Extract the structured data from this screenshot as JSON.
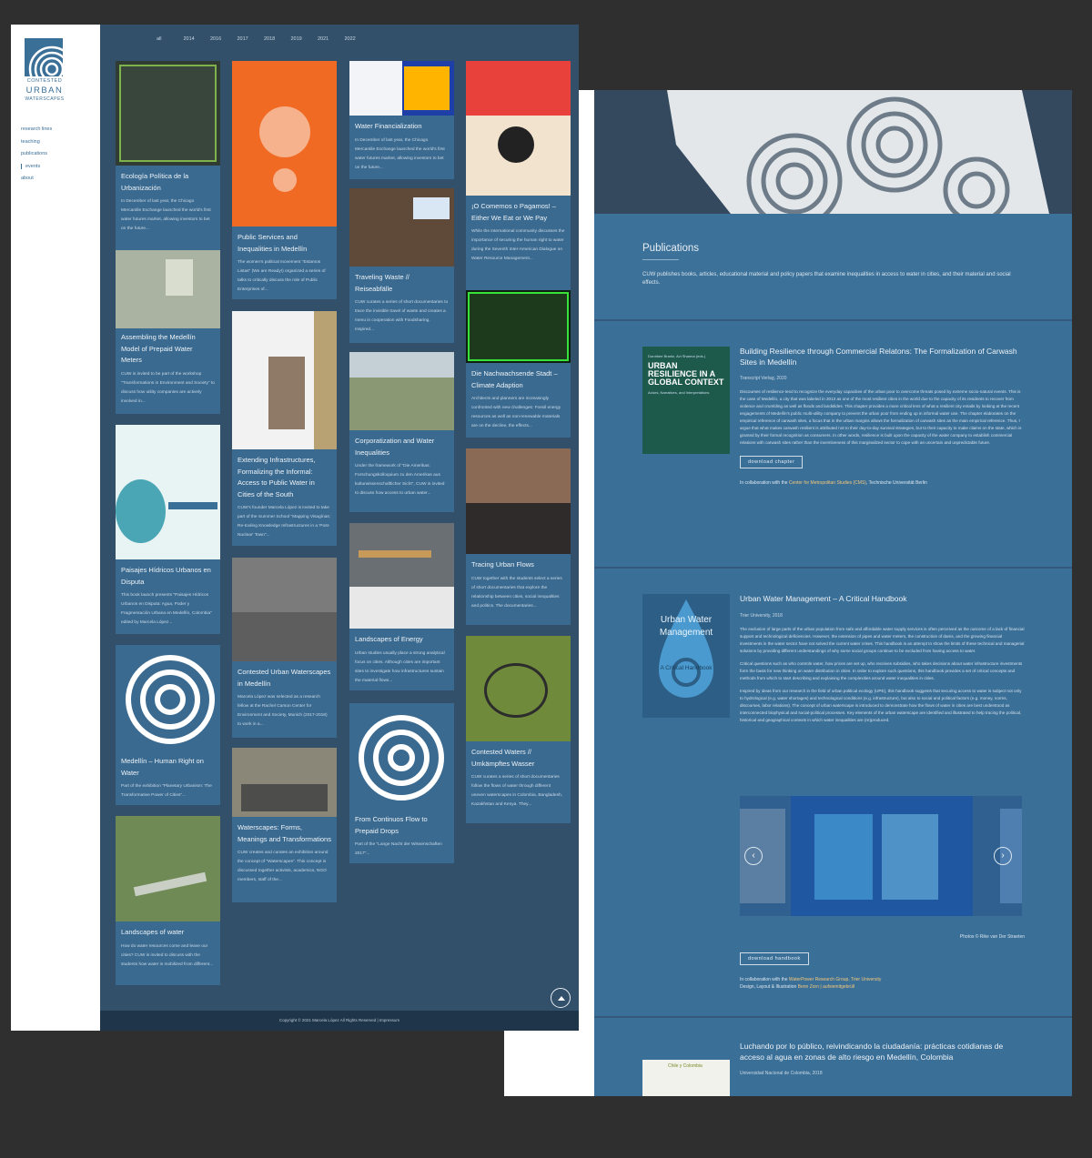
{
  "front": {
    "logo": {
      "line1": "CONTESTED",
      "line2": "URBAN",
      "line3": "WATERSCAPES"
    },
    "nav": [
      "research lines",
      "teaching",
      "publications",
      "events",
      "about"
    ],
    "years": [
      "all",
      "2014",
      "2016",
      "2017",
      "2018",
      "2019",
      "2021",
      "2022"
    ],
    "footer": "Copyright © 2021 Marcela López All Rights Reserved   |   Impressum",
    "cards": [
      {
        "title": "Ecología Política de la Urbanización",
        "desc": "In December of last year, the Chicago Mercantile Exchange launched the world's first water futures market, allowing investors to bet on the future..."
      },
      {
        "title": "Assembling the Medellín Model of Prepaid Water Meters",
        "desc": "CUW is invited to be part of the workshop \"Transformations in Environment and Society\" to discuss how utility companies are actively involved in..."
      },
      {
        "title": "Paisajes Hídricos Urbanos en Disputa",
        "desc": "This book launch presents \"Paisajes Hídricos Urbanos en Disputa: Agua, Poder y Fragmentación Urbana en Medellín, Colombia\" edited by Marcela López..."
      },
      {
        "title": "Medellín – Human Right on Water",
        "desc": "Part of the exhibition \"Planetary Urbanism: The Transformative Power of Cities\"..."
      },
      {
        "title": "Landscapes of water",
        "desc": "How do water resources come and leave our cities? CUW is invited to discuss with the students how water is mobilized from different..."
      },
      {
        "title": "Public Services and Inequalities in Medellín",
        "desc": "The women's political movement \"Estamos Listas\" (We are Ready!) organized a series of talks to critically discuss the role of Public Enterprises of..."
      },
      {
        "title": "Extending Infrastructures, Formalizing the Informal: Access to Public Water in Cities of the South",
        "desc": "CUW's founder Marcela López is invited to take part of the Summer School \"Mapping Visagínas: Re-tooling Knowledge Infrastructures in a 'Post-Nuclear' Town\"..."
      },
      {
        "title": "Contested Urban Waterscapes in Medellín",
        "desc": "Marcela López was selected as a research fellow at the Rachel Carson Center for Environment and Society, Munich (2017-2018) to work in a..."
      },
      {
        "title": "Waterscapes: Forms, Meanings and Transformations",
        "desc": "CUW creates and curates an exhibition around the concept of \"Waterscapes\". This concept is discussed together activists, academics, NGO members, staff of the..."
      },
      {
        "title": "Water Financialization",
        "desc": "In December of last year, the Chicago Mercantile Exchange launched the world's first water futures market, allowing investors to bet on the future..."
      },
      {
        "title": "Traveling Waste // Reiseabfälle",
        "desc": "CUW curates a series of short documentaries to trace the invisible travel of waste and creates a menu in cooperation with Foodsharing. Inspired..."
      },
      {
        "title": "Corporatization and Water Inequalities",
        "desc": "Under the framework of \"Die Amerikas: Forschungskolloquium zu den Amerikas aus kulturwissenschaftlicher Sicht\", CUW is invited to discuss how access to urban water..."
      },
      {
        "title": "Landscapes of Energy",
        "desc": "Urban studies usually place a strong analytical focus on cities. Although cities are important sites to investigate how infrastructures sustain the material flows..."
      },
      {
        "title": "From Continuos Flow to Prepaid Drops",
        "desc": "Part of the \"Lange Nacht der Wissenschaften 2017\"..."
      },
      {
        "title": "¡O Comemos o Pagamos! – Either We Eat or We Pay",
        "desc": "While the international community discusses the importance of securing the human right to water during the Seventh Inter-American Dialogue on Water Resource Management..."
      },
      {
        "title": "Die Nachwachsende Stadt – Climate Adaption",
        "desc": "Architects and planners are increasingly confronted with new challenges: Fossil energy resources as well as non-renewable materials are on the decline, the effects..."
      },
      {
        "title": "Tracing Urban Flows",
        "desc": "CUW together with the students select a series of short documentaries that explore the relationship between cities, social inequalities and politics. The documentaries..."
      },
      {
        "title": "Contested Waters // Umkämpftes Wasser",
        "desc": "CUW curates a series of short documentaries follow the flows of water through different uneven waterscapes in Colombia, Bangladesh, Kazakhstan and Kenya. They..."
      }
    ]
  },
  "back": {
    "title": "Publications",
    "intro": "CUW publishes books, articles, educational material and policy papers that examine inequalities in access to water in cities, and their material and social effects.",
    "entries": [
      {
        "title": "Building Resilience through Commercial Relatons: The Formalization of Carwash Sites in Medellín",
        "meta": "Transcript Verlag, 2020",
        "cover_title": "URBAN RESILIENCE IN A GLOBAL CONTEXT",
        "cover_sub": "Actors, Narratives, and Interpretations",
        "cover_editors": "Dorothee Brantz, Avi Sharma (eds.)",
        "body": "Discourses of resilience tend to recognize the everyday capacities of the urban poor to overcome threats posed by extreme socio-natural events. This is the case of Medellín, a city that was labeled in 2013 as one of the most resilient cities in the world due to the capacity of its residents to recover from violence and crumbling as well as floods and landslides. This chapter provides a more critical lens of what a resilient city entails by looking at the recent engagements of Medellín's public multi-utility company to prevent the urban poor from ending up in informal water use. The chapter elaborates on the empirical reference of carwash sites, a focus that in the urban margins allows the formalization of carwash sites as the main empirical reference. Thus, I argue that what makes carwash resilient is attributed not to their day-to-day survival strategies, but to their capacity to make claims on the state, which is granted by their formal recognition as consumers. In other words, resilience is built upon the capacity of the water company to establish commercial relations with carwash sites rather than the inventiveness of this marginalized sector to cope with an uncertain and unpredictable future.",
        "button": "download chapter",
        "collab_prefix": "In collaboration with the ",
        "collab_link": "Center for Metropolitan Studies (CMS)",
        "collab_suffix": ", Technische Universität Berlin"
      },
      {
        "title": "Urban Water Management – A Critical Handbook",
        "meta": "Trier University, 2018",
        "cover_title": "Urban Water Management",
        "cover_sub": "A Critical Handbook",
        "body1": "The exclusion of large parts of the urban population from safe and affordable water supply services is often perceived as the outcome of a lack of financial support and technological deficiencies. However, the extension of pipes and water meters, the construction of dams, and the growing financial investments in the water sector have not solved the current water crises. This handbook is an attempt to show the limits of these technical and managerial solutions by providing different understandings of why some social groups continue to be excluded from having access to water.",
        "body2": "Critical questions such as who controls water, how prices are set up, who receives subsidies, who takes decisions about water infrastructure investments form the basis for new thinking on water distribution in cities. In order to explore such questions, this handbook provides a set of critical concepts and methods from which to start describing and explaining the complexities around water inequalities in cities.",
        "body3": "Inspired by ideas from our research in the field of urban political ecology (UPE), this handbook suggests that securing access to water is subject not only to hydrological (e.g. water shortages) and technological conditions (e.g. infrastructure), but also to social and political factors (e.g. money, norms, discourses, labor relations). The concept of urban waterscape is introduced to demonstrate how the flows of water in cities are best understood as interconnected biophysical and social-political processes. Key elements of the urban waterscape are identified and illustrated to help tracing the political, historical and geographical contexts in which water inequalities are (re)produced.",
        "photo_credit": "Photos © Rike van Der Straeten",
        "button": "download handbook",
        "collab_prefix": "In collaboration with the ",
        "collab_link": "WaterPower Research Group, Trier University",
        "credit_prefix": "Design, Layout & Illustration ",
        "credit_link": "Benn Zorn | aufsiemitgebrüll"
      },
      {
        "title": "Luchando por lo público, reivindicando la ciudadanía: prácticas cotidianas de acceso al agua en zonas de alto riesgo en Medellín, Colombia",
        "meta": "Universidad Nacional de Colombia, 2018",
        "cover_label": "Chile y Colombia"
      }
    ]
  },
  "colors": {
    "bg": "#2f2f2f",
    "front_bg": "#32506a",
    "card": "#3a6a90",
    "accent": "#3a6f98",
    "highlight": "#f4c87a"
  }
}
